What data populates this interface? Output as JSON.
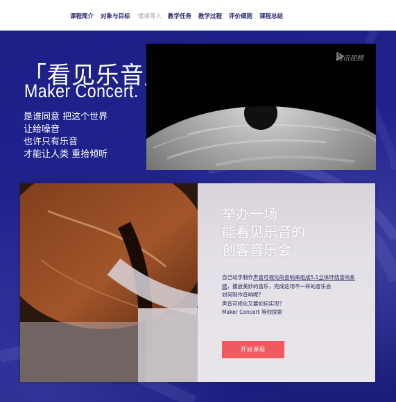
{
  "nav": {
    "items": [
      {
        "label": "课程简介"
      },
      {
        "label": "对象与目标"
      },
      {
        "label": "情境导入",
        "active": true
      },
      {
        "label": "教学任务"
      },
      {
        "label": "教学过程"
      },
      {
        "label": "评价细则"
      },
      {
        "label": "课程总结"
      }
    ]
  },
  "hero": {
    "title_cn": "「看见乐音」",
    "title_en": "Maker Concert.",
    "poem": [
      "是谁同意 把这个世界",
      "让给噪音",
      "也许只有乐音",
      "才能让人类 重拾倾听"
    ]
  },
  "video": {
    "logo_text": "腾讯视频"
  },
  "card": {
    "heading": [
      "举办一场",
      "能看见乐音的",
      "创客音乐会"
    ],
    "body_pre": "自己动手制作",
    "body_link": "声音可视化的音响来组成5.1立体环绕音响系统",
    "body_post": "，播放美妙的音乐，完成这场不一样的音乐会",
    "body_q1": "如何制作音响呢？",
    "body_q2": "声音可视化又要如何实现？",
    "body_q3": "Maker Concert 等你探索",
    "button_label": "开始课程"
  },
  "colors": {
    "background": "#1d1f82",
    "nav_text": "#262a6e",
    "nav_active": "#9da0a8",
    "accent_button": "#f05a5f"
  }
}
